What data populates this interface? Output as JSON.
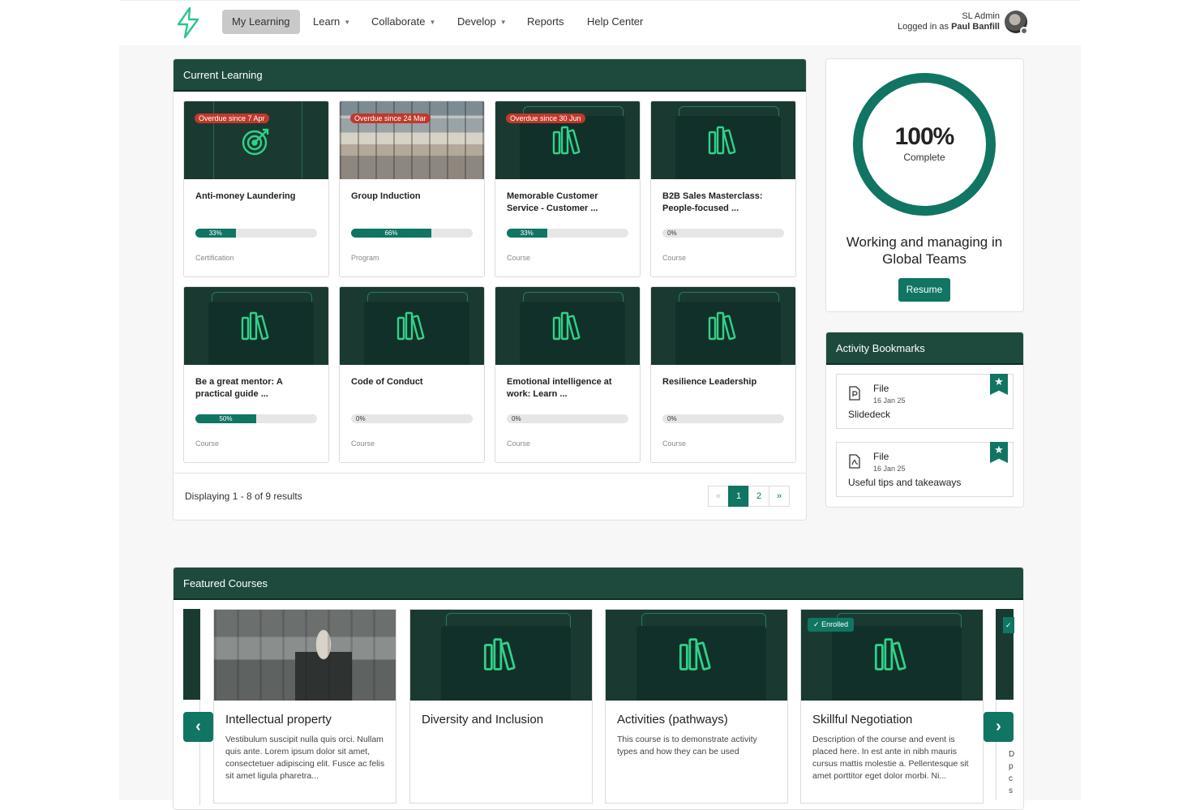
{
  "nav": {
    "items": [
      {
        "label": "My Learning"
      },
      {
        "label": "Learn"
      },
      {
        "label": "Collaborate"
      },
      {
        "label": "Develop"
      },
      {
        "label": "Reports"
      },
      {
        "label": "Help Center"
      }
    ],
    "user_role": "SL Admin",
    "logged_prefix": "Logged in as",
    "user_name": "Paul Banfill"
  },
  "current_learning": {
    "title": "Current Learning",
    "cards": [
      {
        "title": "Anti-money Laundering",
        "overdue": "Overdue since 7 Apr",
        "progress": 33,
        "progress_label": "33%",
        "type": "Certification"
      },
      {
        "title": "Group Induction",
        "overdue": "Overdue since 24 Mar",
        "progress": 66,
        "progress_label": "66%",
        "type": "Program"
      },
      {
        "title": "Memorable Customer Service - Customer ...",
        "overdue": "Overdue since 30 Jun",
        "progress": 33,
        "progress_label": "33%",
        "type": "Course"
      },
      {
        "title": "B2B Sales Masterclass: People-focused ...",
        "overdue": "",
        "progress": 0,
        "progress_label": "0%",
        "type": "Course"
      },
      {
        "title": "Be a great mentor: A practical guide ...",
        "overdue": "",
        "progress": 50,
        "progress_label": "50%",
        "type": "Course"
      },
      {
        "title": "Code of Conduct",
        "overdue": "",
        "progress": 0,
        "progress_label": "0%",
        "type": "Course"
      },
      {
        "title": "Emotional intelligence at work: Learn ...",
        "overdue": "",
        "progress": 0,
        "progress_label": "0%",
        "type": "Course"
      },
      {
        "title": "Resilience Leadership",
        "overdue": "",
        "progress": 0,
        "progress_label": "0%",
        "type": "Course"
      }
    ],
    "results_text": "Displaying 1 - 8 of 9 results",
    "pager": {
      "prev": "«",
      "pages": [
        "1",
        "2"
      ],
      "next": "»",
      "current": 1
    }
  },
  "resume_panel": {
    "percent": "100%",
    "percent_value": 100,
    "sub": "Complete",
    "course_name": "Working and managing in Global Teams",
    "button": "Resume"
  },
  "bookmarks": {
    "title": "Activity Bookmarks",
    "items": [
      {
        "type": "File",
        "date": "16 Jan 25",
        "name": "Slidedeck"
      },
      {
        "type": "File",
        "date": "16 Jan 25",
        "name": "Useful tips and takeaways"
      }
    ]
  },
  "featured": {
    "title": "Featured Courses",
    "enrolled_label": "Enrolled",
    "cards": [
      {
        "title": "Intellectual property",
        "desc": "Vestibulum suscipit nulla quis orci. Nullam quis ante. Lorem ipsum dolor sit amet, consectetuer adipiscing elit. Fusce ac felis sit amet ligula pharetra..."
      },
      {
        "title": "Diversity and Inclusion",
        "desc": ""
      },
      {
        "title": "Activities (pathways)",
        "desc": "This course is to demonstrate activity types and how they can be used"
      },
      {
        "title": "Skillful Negotiation",
        "desc": "Description of the course and event is placed here. In est ante in nibh mauris cursus mattis molestie a. Pellentesque sit amet porttitor eget dolor morbi. Ni..."
      }
    ],
    "partial_next_letters": "D p c s",
    "prev_icon": "chevron-left-icon",
    "next_icon": "chevron-right-icon"
  },
  "colors": {
    "brand_dark": "#1e4a3d",
    "accent": "#107563",
    "overdue": "#c0392b"
  }
}
